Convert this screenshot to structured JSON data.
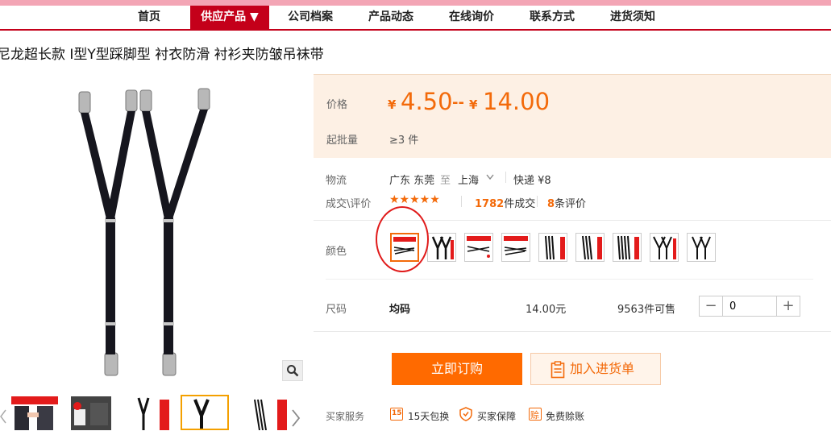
{
  "nav": {
    "items": [
      "首页",
      "供应产品 ▼",
      "公司档案",
      "产品动态",
      "在线询价",
      "联系方式",
      "进货须知"
    ]
  },
  "product": {
    "title": "尼龙超长款 I型Y型踩脚型 衬衣防滑 衬衫夹防皱吊袜带"
  },
  "price": {
    "label": "价格",
    "currency": "¥",
    "low": "4.50",
    "separator": "--",
    "high": "14.00",
    "moq_label": "起批量",
    "moq_value": "≥3 件"
  },
  "logistics": {
    "label": "物流",
    "from": "广东 东莞",
    "to_word": "至",
    "to": "上海",
    "shipping": "快递 ¥8"
  },
  "deals": {
    "label": "成交\\评价",
    "stars": "★★★★★",
    "sold_count": "1782",
    "sold_suffix": "件成交",
    "review_count": "8",
    "review_suffix": "条评价"
  },
  "color": {
    "label": "颜色",
    "selected_index": 0
  },
  "size": {
    "label": "尺码",
    "value": "均码",
    "price": "14.00元",
    "stock": "9563件可售",
    "quantity": "0",
    "minus": "−",
    "plus": "+"
  },
  "actions": {
    "buy": "立即订购",
    "cart": "加入进货单"
  },
  "services": {
    "label": "买家服务",
    "items": [
      "15天包换",
      "买家保障",
      "免费赊账"
    ],
    "icon_glyphs": [
      "15",
      "",
      "赊"
    ]
  },
  "colors": {
    "brand_red": "#c4001a",
    "price_orange": "#f36a0a",
    "buy_button": "#ff6a00"
  }
}
